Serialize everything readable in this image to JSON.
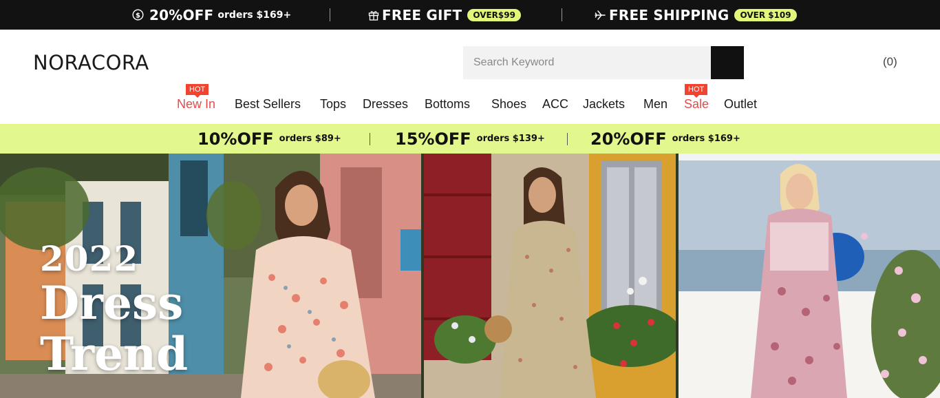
{
  "topbar": {
    "items": [
      {
        "big": "20%OFF",
        "small": "orders $169+",
        "icon": "dollar-coin-icon"
      },
      {
        "big": "FREE GIFT",
        "pill": "OVER$99",
        "icon": "gift-icon"
      },
      {
        "big": "FREE SHIPPING",
        "pill": "OVER $109",
        "icon": "plane-icon"
      }
    ]
  },
  "header": {
    "logo": "NORACORA",
    "search_placeholder": "Search Keyword",
    "cart_count": "(0)"
  },
  "nav": {
    "items": [
      {
        "label": "New In",
        "hot": true,
        "badge": "HOT"
      },
      {
        "label": "Best Sellers"
      },
      {
        "label": "Tops"
      },
      {
        "label": "Dresses"
      },
      {
        "label": "Bottoms"
      },
      {
        "label": "Shoes"
      },
      {
        "label": "ACC"
      },
      {
        "label": "Jackets"
      },
      {
        "label": "Men"
      },
      {
        "label": "Sale",
        "hot": true,
        "badge": "HOT"
      },
      {
        "label": "Outlet"
      }
    ]
  },
  "discount_strip": {
    "items": [
      {
        "big": "10%OFF",
        "small": "orders $89+"
      },
      {
        "big": "15%OFF",
        "small": "orders $139+"
      },
      {
        "big": "20%OFF",
        "small": "orders $169+"
      }
    ]
  },
  "hero": {
    "line1": "2022",
    "line2": "Dress",
    "line3": "Trend"
  },
  "colors": {
    "topbar_bg": "#121212",
    "accent_lime": "#e2f78c",
    "hot_red": "#f04430",
    "hot_text": "#e84a4a"
  }
}
